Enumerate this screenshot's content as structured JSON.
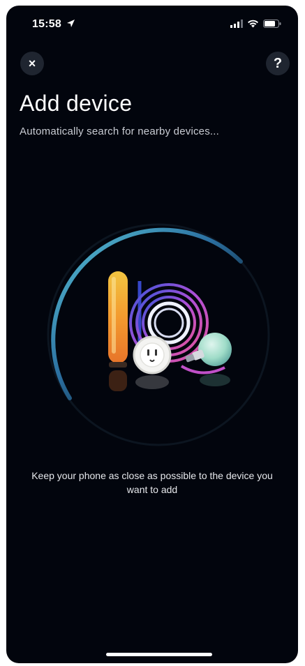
{
  "status_bar": {
    "time": "15:58"
  },
  "header": {
    "title": "Add device",
    "subtitle": "Automatically search for nearby devices...",
    "close_label": "×",
    "help_label": "?"
  },
  "hint": {
    "text": "Keep your phone as close as possible to the device you want to add"
  },
  "colors": {
    "background": "#02050d",
    "button_bg": "#1f2530",
    "scan_ring": "#3aa6c8"
  },
  "icons": [
    "location-arrow-icon",
    "signal-icon",
    "wifi-icon",
    "battery-icon",
    "close-icon",
    "help-icon"
  ]
}
